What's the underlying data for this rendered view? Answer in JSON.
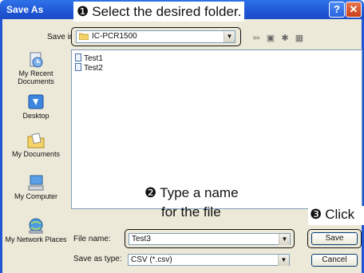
{
  "window": {
    "title": "Save As",
    "help_symbol": "?",
    "close_symbol": "✕"
  },
  "annotations": {
    "step1_num": "❶",
    "step1_text": "Select the desired folder.",
    "step2_num": "❷",
    "step2_line1": "Type a name",
    "step2_line2": "for the file",
    "step3_num": "❸",
    "step3_text": "Click"
  },
  "save_in": {
    "label": "Save in:",
    "value": "IC-PCR1500"
  },
  "toolbar_icons": [
    "back-icon",
    "up-folder-icon",
    "new-folder-icon",
    "views-menu-icon"
  ],
  "places": [
    {
      "label": "My Recent Documents",
      "icon": "recent-documents-icon"
    },
    {
      "label": "Desktop",
      "icon": "desktop-icon"
    },
    {
      "label": "My Documents",
      "icon": "my-documents-icon"
    },
    {
      "label": "My Computer",
      "icon": "my-computer-icon"
    },
    {
      "label": "My Network Places",
      "icon": "network-places-icon"
    }
  ],
  "files": [
    "Test1",
    "Test2"
  ],
  "file_name": {
    "label": "File name:",
    "value": "Test3"
  },
  "save_as_type": {
    "label": "Save as type:",
    "value": "CSV (*.csv)"
  },
  "buttons": {
    "save": "Save",
    "cancel": "Cancel"
  },
  "colors": {
    "titlebar": "#1f56d5",
    "dialog_bg": "#ece9d8",
    "close": "#c9401a"
  }
}
